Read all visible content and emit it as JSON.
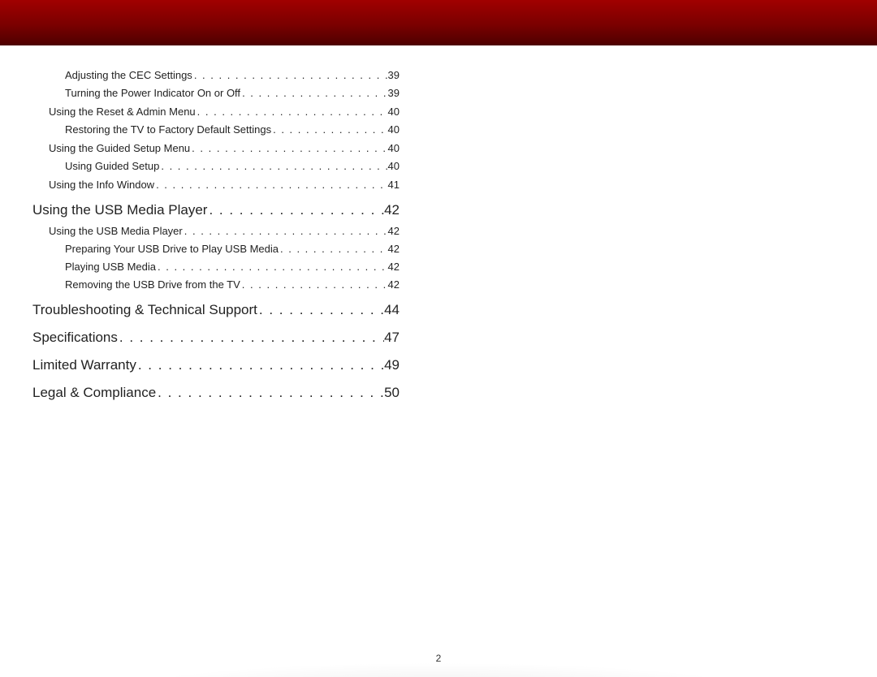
{
  "page_number": "2",
  "toc": [
    {
      "level": 3,
      "title": "Adjusting the CEC Settings",
      "page": "39"
    },
    {
      "level": 3,
      "title": "Turning the Power Indicator On or Off",
      "page": "39"
    },
    {
      "level": 2,
      "title": "Using the Reset & Admin Menu",
      "page": "40"
    },
    {
      "level": 3,
      "title": "Restoring the TV to Factory Default Settings",
      "page": "40"
    },
    {
      "level": 2,
      "title": "Using the Guided Setup Menu",
      "page": "40"
    },
    {
      "level": 3,
      "title": "Using Guided Setup",
      "page": "40"
    },
    {
      "level": 2,
      "title": "Using the Info Window",
      "page": "41"
    },
    {
      "level": 1,
      "title": "Using the USB Media Player",
      "page": "42"
    },
    {
      "level": 2,
      "title": "Using the USB Media Player",
      "page": "42"
    },
    {
      "level": 3,
      "title": "Preparing Your USB Drive to Play USB Media",
      "page": "42"
    },
    {
      "level": 3,
      "title": "Playing USB Media",
      "page": "42"
    },
    {
      "level": 3,
      "title": "Removing the USB Drive from the TV",
      "page": "42"
    },
    {
      "level": 1,
      "title": "Troubleshooting & Technical Support",
      "page": "44"
    },
    {
      "level": 1,
      "title": "Specifications",
      "page": "47"
    },
    {
      "level": 1,
      "title": "Limited Warranty",
      "page": "49"
    },
    {
      "level": 1,
      "title": "Legal & Compliance",
      "page": "50"
    }
  ],
  "dot_leader": ". . . . . . . . . . . . . . . . . . . . . . . . . . . . . . . . . . . . . . . . . . . . . . . . . . . . . . . . . . . . . . . . . . . . . . . . . . . . . . . ."
}
